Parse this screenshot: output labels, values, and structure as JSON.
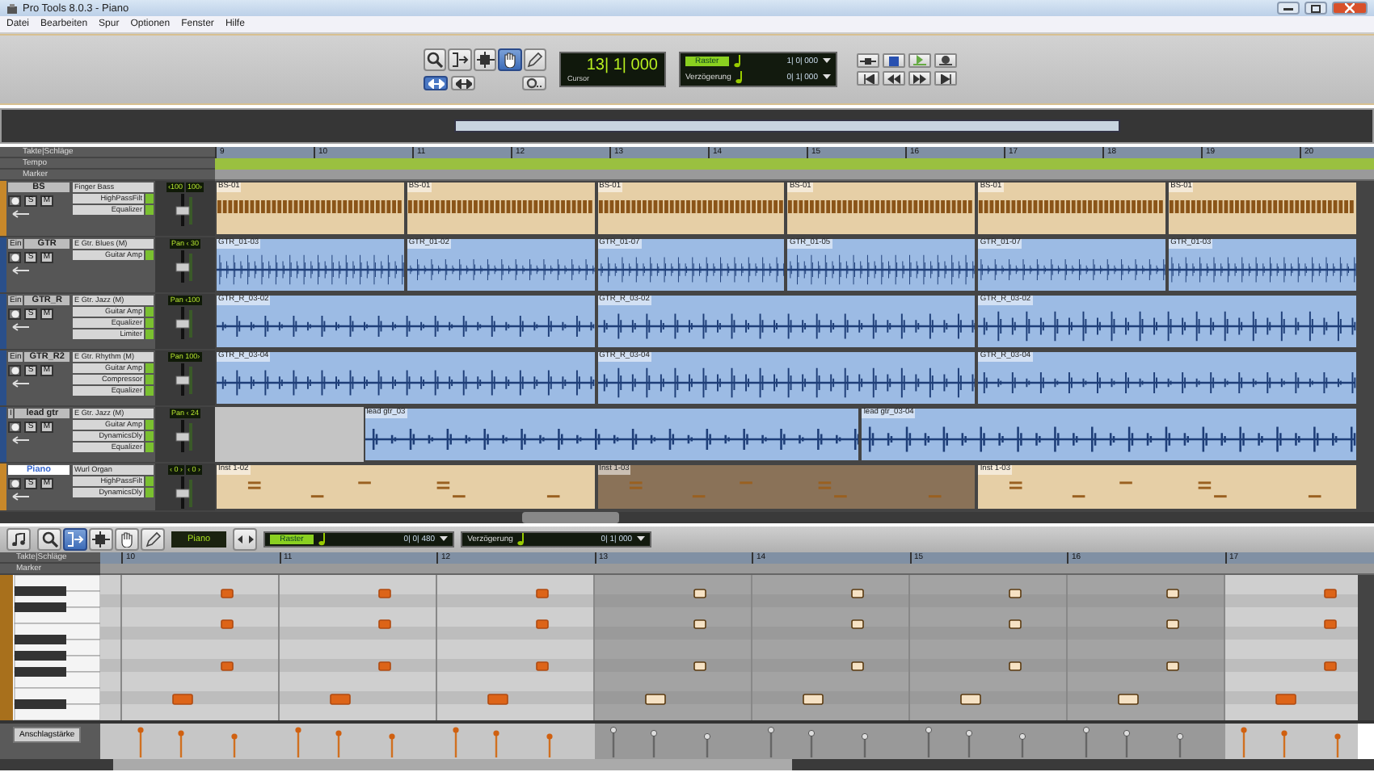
{
  "window": {
    "title": "Pro Tools 8.0.3 - Piano"
  },
  "menu": [
    {
      "label": "Datei"
    },
    {
      "label": "Bearbeiten"
    },
    {
      "label": "Spur"
    },
    {
      "label": "Optionen"
    },
    {
      "label": "Fenster"
    },
    {
      "label": "Hilfe"
    }
  ],
  "toolbar": {
    "tools": [
      {
        "kind": "zoom",
        "selected": false
      },
      {
        "kind": "trim",
        "selected": false
      },
      {
        "kind": "select",
        "selected": false
      },
      {
        "kind": "grab",
        "selected": true
      },
      {
        "kind": "pencil",
        "selected": false
      }
    ],
    "modes": [
      {
        "selected": true
      },
      {
        "selected": false
      }
    ],
    "counter": {
      "value": "13| 1| 000",
      "label": "Cursor"
    },
    "grid": {
      "label": "Raster",
      "value": "1| 0| 000"
    },
    "nudge": {
      "label": "Verzögerung",
      "value": "0| 1| 000"
    }
  },
  "edit": {
    "rulers": {
      "bars_label": "Takte|Schläge",
      "bars": [
        "9",
        "10",
        "11",
        "12",
        "13",
        "14",
        "15",
        "16",
        "17",
        "18",
        "19",
        "20"
      ],
      "tempo_label": "Tempo",
      "marker_label": "Marker"
    },
    "tracks": [
      {
        "name": "BS",
        "selected": false,
        "color": "#c8882a",
        "kind": "midi",
        "solo": "S",
        "mute": "M",
        "instrument": "Finger Bass",
        "inserts": [
          "HighPassFilt",
          "Equalizer"
        ],
        "pan": [
          "‹100",
          "100›"
        ],
        "clips": [
          {
            "kind": "clip",
            "name": "BS-01",
            "selected": false
          },
          {
            "kind": "clip",
            "name": "BS-01",
            "selected": false
          },
          {
            "kind": "clip",
            "name": "BS-01",
            "selected": false
          },
          {
            "kind": "clip",
            "name": "BS-01",
            "selected": false
          },
          {
            "kind": "clip",
            "name": "BS-01",
            "selected": false
          },
          {
            "kind": "clip",
            "name": "BS-01",
            "selected": false
          }
        ]
      },
      {
        "name": "GTR",
        "mode": "Ein",
        "selected": false,
        "color": "#2a4f8a",
        "kind": "audio",
        "solo": "S",
        "mute": "M",
        "instrument": "E Gtr. Blues (M)",
        "inserts": [
          "Guitar Amp"
        ],
        "pan": [
          "Pan ‹ 30"
        ],
        "clips": [
          {
            "kind": "clip",
            "name": "GTR_01-03",
            "selected": false
          },
          {
            "kind": "clip",
            "name": "GTR_01-02",
            "selected": false
          },
          {
            "kind": "clip",
            "name": "GTR_01-07",
            "selected": false
          },
          {
            "kind": "clip",
            "name": "GTR_01-05",
            "selected": false
          },
          {
            "kind": "clip",
            "name": "GTR_01-07",
            "selected": false
          },
          {
            "kind": "clip",
            "name": "GTR_01-03",
            "selected": false
          }
        ]
      },
      {
        "name": "GTR_R",
        "mode": "Ein",
        "selected": false,
        "color": "#2a4f8a",
        "kind": "audio",
        "solo": "S",
        "mute": "M",
        "instrument": "E Gtr. Jazz (M)",
        "inserts": [
          "Guitar Amp",
          "Equalizer",
          "Limiter"
        ],
        "pan": [
          "Pan ‹100"
        ],
        "clips": [
          {
            "kind": "clip",
            "name": "GTR_R_03-02",
            "selected": false
          },
          {
            "kind": "clip",
            "name": "GTR_R_03-02",
            "selected": false
          },
          {
            "kind": "clip",
            "name": "GTR_R_03-02",
            "selected": false
          }
        ]
      },
      {
        "name": "GTR_R2",
        "mode": "Ein",
        "selected": false,
        "color": "#2a4f8a",
        "kind": "audio",
        "solo": "S",
        "mute": "M",
        "instrument": "E Gtr. Rhythm (M)",
        "inserts": [
          "Guitar Amp",
          "Compressor",
          "Equalizer"
        ],
        "pan": [
          "Pan 100›"
        ],
        "clips": [
          {
            "kind": "clip",
            "name": "GTR_R_03-04",
            "selected": false
          },
          {
            "kind": "clip",
            "name": "GTR_R_03-04",
            "selected": false
          },
          {
            "kind": "clip",
            "name": "GTR_R_03-04",
            "selected": false
          }
        ]
      },
      {
        "name": "lead gtr",
        "mode": "I",
        "selected": false,
        "color": "#2a4f8a",
        "kind": "audio",
        "solo": "S",
        "mute": "M",
        "instrument": "E Gtr. Jazz (M)",
        "inserts": [
          "Guitar Amp",
          "DynamicsDly",
          "Equalizer"
        ],
        "pan": [
          "Pan ‹ 24"
        ],
        "clips": [
          {
            "kind": "gap"
          },
          {
            "kind": "clip",
            "name": "lead gtr_03",
            "selected": false
          },
          {
            "kind": "clip",
            "name": "lead gtr_03-04",
            "selected": false
          }
        ]
      },
      {
        "name": "Piano",
        "selected": true,
        "color": "#c8882a",
        "kind": "midi-sparse",
        "solo": "S",
        "mute": "M",
        "instrument": "Wurl Organ",
        "inserts": [
          "HighPassFilt",
          "DynamicsDly"
        ],
        "pan": [
          "‹ 0 ›",
          "‹ 0 ›"
        ],
        "clips": [
          {
            "kind": "clip",
            "name": "Inst 1-02",
            "selected": false
          },
          {
            "kind": "clip",
            "name": "Inst 1-03",
            "selected": true
          },
          {
            "kind": "clip",
            "name": "Inst 1-03",
            "selected": false
          }
        ]
      }
    ]
  },
  "midi_editor": {
    "tools": [
      {
        "kind": "zoom",
        "selected": false
      },
      {
        "kind": "trim",
        "selected": true
      },
      {
        "kind": "select",
        "selected": false
      },
      {
        "kind": "grab",
        "selected": false
      },
      {
        "kind": "pencil",
        "selected": false
      }
    ],
    "track_name": "Piano",
    "grid": {
      "label": "Raster",
      "value": "0| 0| 480"
    },
    "nudge": {
      "label": "Verzögerung",
      "value": "0| 1| 000"
    },
    "rulers": {
      "bars_label": "Takte|Schläge",
      "bars": [
        "10",
        "11",
        "12",
        "13",
        "14",
        "15",
        "16",
        "17"
      ],
      "marker_label": "Marker"
    },
    "velocity_label": "Anschlagstärke"
  }
}
